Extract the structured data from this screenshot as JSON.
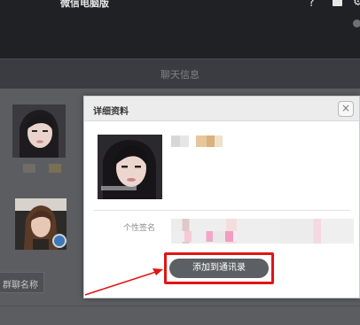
{
  "app": {
    "title": "微信电脑版",
    "help_icon": "?",
    "gear_icon": "⚙"
  },
  "chat": {
    "title": "聊天信息",
    "group_name_button": "群聊名称"
  },
  "modal": {
    "title": "详细资料",
    "close_glyph": "×",
    "signature_label": "个性签名",
    "add_button_label": "添加到通讯录"
  },
  "colors": {
    "highlight": "#e11414",
    "button": "#5c6064"
  }
}
